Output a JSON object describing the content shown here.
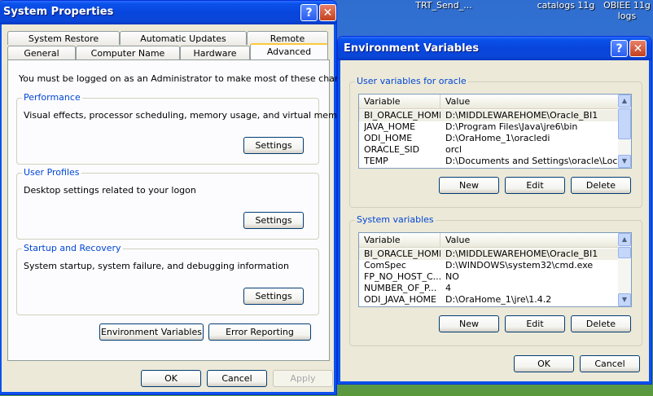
{
  "desktop": {
    "icons": [
      {
        "label": "TRT_Send_..."
      },
      {
        "label": "catalogs 11g"
      },
      {
        "label": "OBIEE 11g logs"
      }
    ]
  },
  "sysprops": {
    "title": "System Properties",
    "tabs_row1": [
      "System Restore",
      "Automatic Updates",
      "Remote"
    ],
    "tabs_row2": [
      "General",
      "Computer Name",
      "Hardware",
      "Advanced"
    ],
    "admin_note": "You must be logged on as an Administrator to make most of these changes.",
    "performance": {
      "label": "Performance",
      "desc": "Visual effects, processor scheduling, memory usage, and virtual memory",
      "button": "Settings"
    },
    "profiles": {
      "label": "User Profiles",
      "desc": "Desktop settings related to your logon",
      "button": "Settings"
    },
    "startup": {
      "label": "Startup and Recovery",
      "desc": "System startup, system failure, and debugging information",
      "button": "Settings"
    },
    "env_button": "Environment Variables",
    "error_button": "Error Reporting",
    "ok": "OK",
    "cancel": "Cancel",
    "apply": "Apply"
  },
  "envvars": {
    "title": "Environment Variables",
    "user_group_label": "User variables for oracle",
    "system_group_label": "System variables",
    "col_variable": "Variable",
    "col_value": "Value",
    "user_rows": [
      {
        "var": "BI_ORACLE_HOME",
        "val": "D:\\MIDDLEWAREHOME\\Oracle_BI1"
      },
      {
        "var": "JAVA_HOME",
        "val": "D:\\Program Files\\Java\\jre6\\bin"
      },
      {
        "var": "ODI_HOME",
        "val": "D:\\OraHome_1\\oracledi"
      },
      {
        "var": "ORACLE_SID",
        "val": "orcl"
      },
      {
        "var": "TEMP",
        "val": "D:\\Documents and Settings\\oracle\\Local..."
      }
    ],
    "system_rows": [
      {
        "var": "BI_ORACLE_HOME",
        "val": "D:\\MIDDLEWAREHOME\\Oracle_BI1"
      },
      {
        "var": "ComSpec",
        "val": "D:\\WINDOWS\\system32\\cmd.exe"
      },
      {
        "var": "FP_NO_HOST_C...",
        "val": "NO"
      },
      {
        "var": "NUMBER_OF_P...",
        "val": "4"
      },
      {
        "var": "ODI_JAVA_HOME",
        "val": "D:\\OraHome_1\\jre\\1.4.2"
      }
    ],
    "new": "New",
    "edit": "Edit",
    "delete": "Delete",
    "ok": "OK",
    "cancel": "Cancel"
  }
}
